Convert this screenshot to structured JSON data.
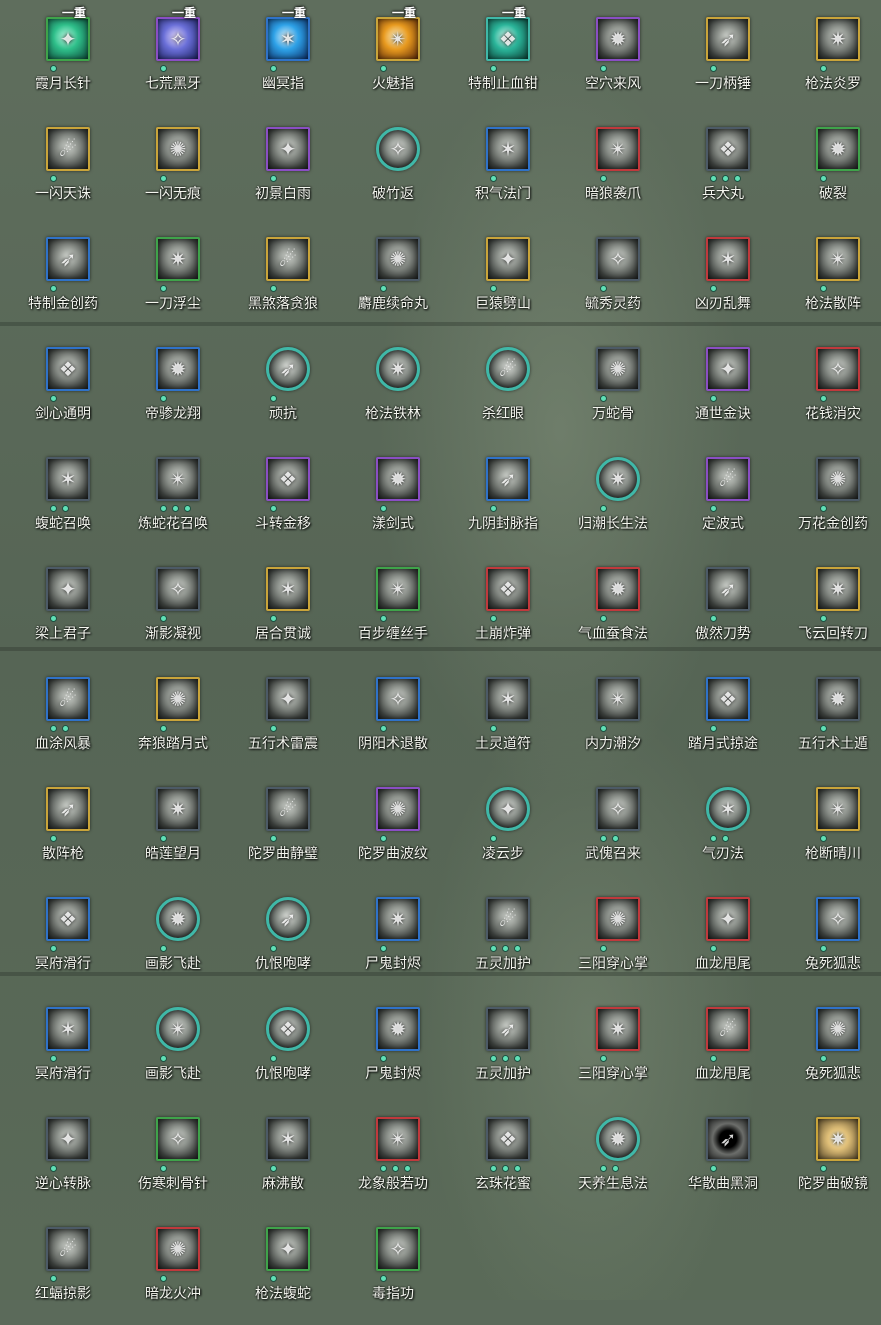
{
  "skills": [
    {
      "name": "霞月长针",
      "rank": "一重",
      "frame": "green",
      "fx": "fx-green",
      "dots": 1
    },
    {
      "name": "七荒黑牙",
      "rank": "一重",
      "frame": "purple",
      "fx": "fx-purple",
      "dots": 1
    },
    {
      "name": "幽冥指",
      "rank": "一重",
      "frame": "blue",
      "fx": "fx-blue",
      "dots": 1
    },
    {
      "name": "火魅指",
      "rank": "一重",
      "frame": "gold",
      "fx": "fx-orange",
      "dots": 1
    },
    {
      "name": "特制止血钳",
      "rank": "一重",
      "frame": "teal",
      "fx": "fx-teal",
      "dots": 1
    },
    {
      "name": "空穴来风",
      "frame": "purple",
      "dots": 1
    },
    {
      "name": "一刀柄锤",
      "frame": "gold",
      "dots": 1
    },
    {
      "name": "枪法炎罗",
      "frame": "gold",
      "dots": 1
    },
    {
      "name": "一闪天诛",
      "frame": "gold",
      "dots": 1
    },
    {
      "name": "一闪无痕",
      "frame": "gold",
      "dots": 1
    },
    {
      "name": "初景白雨",
      "frame": "purple",
      "dots": 1
    },
    {
      "name": "破竹返",
      "frame": "round",
      "dots": 0
    },
    {
      "name": "积气法门",
      "frame": "blue",
      "dots": 1
    },
    {
      "name": "暗狼袭爪",
      "frame": "red",
      "dots": 1
    },
    {
      "name": "兵犬丸",
      "frame": "dark",
      "dots": 3
    },
    {
      "name": "破裂",
      "frame": "green",
      "dots": 1
    },
    {
      "name": "特制金创药",
      "frame": "blue",
      "dots": 1
    },
    {
      "name": "一刀浮尘",
      "frame": "green",
      "dots": 1
    },
    {
      "name": "黑煞落贪狼",
      "frame": "gold",
      "dots": 1
    },
    {
      "name": "麝鹿续命丸",
      "frame": "dark",
      "dots": 1
    },
    {
      "name": "巨猿劈山",
      "frame": "gold",
      "dots": 1
    },
    {
      "name": "毓秀灵药",
      "frame": "dark",
      "dots": 1
    },
    {
      "name": "凶刃乱舞",
      "frame": "red",
      "dots": 1
    },
    {
      "name": "枪法散阵",
      "frame": "gold",
      "dots": 1
    },
    {
      "name": "剑心通明",
      "frame": "blue",
      "dots": 1
    },
    {
      "name": "帝骖龙翔",
      "frame": "blue",
      "dots": 1
    },
    {
      "name": "顽抗",
      "frame": "round",
      "dots": 1
    },
    {
      "name": "枪法铁林",
      "frame": "round",
      "dots": 0
    },
    {
      "name": "杀红眼",
      "frame": "round",
      "dots": 0
    },
    {
      "name": "万蛇骨",
      "frame": "dark",
      "dots": 1
    },
    {
      "name": "通世金诀",
      "frame": "purple",
      "dots": 1
    },
    {
      "name": "花钱消灾",
      "frame": "red",
      "dots": 1
    },
    {
      "name": "蝮蛇召唤",
      "frame": "dark",
      "dots": 2
    },
    {
      "name": "炼蛇花召唤",
      "frame": "dark",
      "dots": 3
    },
    {
      "name": "斗转金移",
      "frame": "purple",
      "dots": 1
    },
    {
      "name": "漾剑式",
      "frame": "purple",
      "dots": 1
    },
    {
      "name": "九阴封脉指",
      "frame": "blue",
      "dots": 1
    },
    {
      "name": "归潮长生法",
      "frame": "round",
      "dots": 1
    },
    {
      "name": "定波式",
      "frame": "purple",
      "dots": 1
    },
    {
      "name": "万花金创药",
      "frame": "dark",
      "dots": 1
    },
    {
      "name": "梁上君子",
      "frame": "dark",
      "dots": 1
    },
    {
      "name": "渐影凝视",
      "frame": "dark",
      "dots": 1
    },
    {
      "name": "居合贯诚",
      "frame": "gold",
      "dots": 1
    },
    {
      "name": "百步缠丝手",
      "frame": "green",
      "dots": 1
    },
    {
      "name": "土崩炸弹",
      "frame": "red",
      "dots": 1
    },
    {
      "name": "气血蚕食法",
      "frame": "red",
      "dots": 1
    },
    {
      "name": "傲然刀势",
      "frame": "dark",
      "dots": 1
    },
    {
      "name": "飞云回转刀",
      "frame": "gold",
      "dots": 1
    },
    {
      "name": "血涂风暴",
      "frame": "blue",
      "dots": 2
    },
    {
      "name": "奔狼踏月式",
      "frame": "gold",
      "dots": 1
    },
    {
      "name": "五行术雷震",
      "frame": "dark",
      "dots": 1
    },
    {
      "name": "阴阳术退散",
      "frame": "blue",
      "dots": 1
    },
    {
      "name": "土灵道符",
      "frame": "dark",
      "dots": 1
    },
    {
      "name": "内力潮汐",
      "frame": "dark",
      "dots": 1
    },
    {
      "name": "踏月式掠途",
      "frame": "blue",
      "dots": 1
    },
    {
      "name": "五行术土遁",
      "frame": "dark",
      "dots": 1
    },
    {
      "name": "散阵枪",
      "frame": "gold",
      "dots": 1
    },
    {
      "name": "皓莲望月",
      "frame": "dark",
      "dots": 1
    },
    {
      "name": "陀罗曲静璧",
      "frame": "dark",
      "dots": 1
    },
    {
      "name": "陀罗曲波纹",
      "frame": "purple",
      "dots": 1
    },
    {
      "name": "凌云步",
      "frame": "round",
      "dots": 1
    },
    {
      "name": "武傀召来",
      "frame": "dark",
      "dots": 2
    },
    {
      "name": "气刃法",
      "frame": "round",
      "dots": 2
    },
    {
      "name": "枪断晴川",
      "frame": "gold",
      "dots": 1
    },
    {
      "name": "冥府滑行",
      "frame": "blue",
      "dots": 1
    },
    {
      "name": "画影飞赴",
      "frame": "round",
      "dots": 1
    },
    {
      "name": "仇恨咆哮",
      "frame": "round",
      "dots": 1
    },
    {
      "name": "尸鬼封烬",
      "frame": "blue",
      "dots": 1
    },
    {
      "name": "五灵加护",
      "frame": "dark",
      "dots": 3
    },
    {
      "name": "三阳穿心掌",
      "frame": "red",
      "dots": 1
    },
    {
      "name": "血龙甩尾",
      "frame": "red",
      "dots": 1
    },
    {
      "name": "兔死狐悲",
      "frame": "blue",
      "dots": 1
    },
    {
      "name": "冥府滑行",
      "frame": "blue",
      "dots": 1
    },
    {
      "name": "画影飞赴",
      "frame": "round",
      "dots": 1
    },
    {
      "name": "仇恨咆哮",
      "frame": "round",
      "dots": 1
    },
    {
      "name": "尸鬼封烬",
      "frame": "blue",
      "dots": 1
    },
    {
      "name": "五灵加护",
      "frame": "dark",
      "dots": 3
    },
    {
      "name": "三阳穿心掌",
      "frame": "red",
      "dots": 1
    },
    {
      "name": "血龙甩尾",
      "frame": "red",
      "dots": 1
    },
    {
      "name": "兔死狐悲",
      "frame": "blue",
      "dots": 1
    },
    {
      "name": "逆心转脉",
      "frame": "dark",
      "dots": 1
    },
    {
      "name": "伤寒刺骨针",
      "frame": "green",
      "dots": 1
    },
    {
      "name": "麻沸散",
      "frame": "dark",
      "dots": 1
    },
    {
      "name": "龙象般若功",
      "frame": "red",
      "dots": 3
    },
    {
      "name": "玄珠花蜜",
      "frame": "dark",
      "dots": 3
    },
    {
      "name": "天养生息法",
      "frame": "round",
      "dots": 2
    },
    {
      "name": "华散曲黑洞",
      "frame": "dark",
      "fx": "fx-void",
      "dots": 1
    },
    {
      "name": "陀罗曲破镜",
      "frame": "gold",
      "fx": "fx-sun",
      "dots": 1
    },
    {
      "name": "红蝠掠影",
      "frame": "dark",
      "dots": 1
    },
    {
      "name": "暗龙火冲",
      "frame": "red",
      "dots": 1
    },
    {
      "name": "枪法蝮蛇",
      "frame": "green",
      "dots": 1
    },
    {
      "name": "毒指功",
      "frame": "green",
      "dots": 1
    }
  ]
}
